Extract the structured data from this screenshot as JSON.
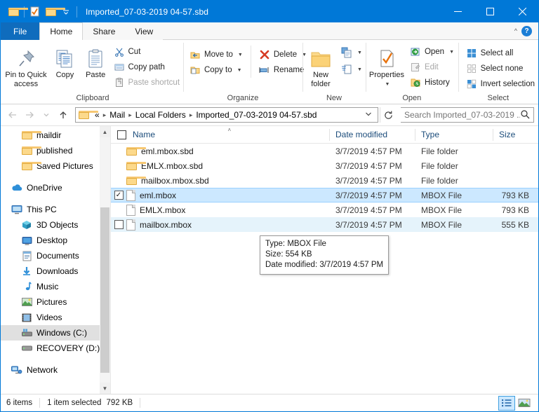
{
  "window": {
    "title": "Imported_07-03-2019 04-57.sbd",
    "accent": "#0078d7",
    "quick_access": [
      "folder-icon",
      "properties-check-icon",
      "folder-icon",
      "chevron-down-icon"
    ],
    "controls": {
      "minimize": "minimize-icon",
      "maximize": "maximize-icon",
      "close": "close-icon"
    }
  },
  "ribbon": {
    "tabs": [
      {
        "label": "File",
        "type": "file"
      },
      {
        "label": "Home",
        "type": "active"
      },
      {
        "label": "Share",
        "type": "inactive"
      },
      {
        "label": "View",
        "type": "inactive"
      }
    ],
    "collapse_icon": "chevron-up-icon",
    "help_label": "?",
    "groups": [
      {
        "name": "Clipboard",
        "big": [
          {
            "label": "Pin to Quick access",
            "icon": "pin-icon"
          },
          {
            "label": "Copy",
            "icon": "copy-icon"
          },
          {
            "label": "Paste",
            "icon": "paste-icon"
          }
        ],
        "small": [
          {
            "label": "Cut",
            "icon": "scissors-icon",
            "disabled": false
          },
          {
            "label": "Copy path",
            "icon": "copy-path-icon",
            "disabled": false
          },
          {
            "label": "Paste shortcut",
            "icon": "paste-shortcut-icon",
            "disabled": true
          }
        ]
      },
      {
        "name": "Organize",
        "small": [
          {
            "label": "Move to",
            "icon": "move-to-icon",
            "dropdown": true
          },
          {
            "label": "Copy to",
            "icon": "copy-to-icon",
            "dropdown": true
          }
        ],
        "small2": [
          {
            "label": "Delete",
            "icon": "delete-x-icon",
            "dropdown": true
          },
          {
            "label": "Rename",
            "icon": "rename-icon",
            "dropdown": false
          }
        ]
      },
      {
        "name": "New",
        "big": [
          {
            "label": "New folder",
            "icon": "new-folder-icon"
          }
        ],
        "small": [
          {
            "label": "",
            "icon": "new-item-icon",
            "dropdown": true
          },
          {
            "label": "",
            "icon": "easy-access-icon",
            "dropdown": true
          }
        ]
      },
      {
        "name": "Open",
        "big": [
          {
            "label": "Properties",
            "icon": "properties-icon",
            "dropdown": true
          }
        ],
        "small": [
          {
            "label": "Open",
            "icon": "open-icon",
            "dropdown": true,
            "disabled": false
          },
          {
            "label": "Edit",
            "icon": "edit-icon",
            "dropdown": false,
            "disabled": true
          },
          {
            "label": "History",
            "icon": "history-icon",
            "dropdown": false,
            "disabled": false
          }
        ]
      },
      {
        "name": "Select",
        "small": [
          {
            "label": "Select all",
            "icon": "select-all-icon"
          },
          {
            "label": "Select none",
            "icon": "select-none-icon"
          },
          {
            "label": "Invert selection",
            "icon": "invert-selection-icon"
          }
        ]
      }
    ]
  },
  "address": {
    "back_icon": "arrow-left-icon",
    "forward_icon": "arrow-right-icon",
    "recent_icon": "chevron-down-icon",
    "up_icon": "arrow-up-icon",
    "folder_icon": "folder-icon",
    "overflow": "«",
    "crumbs": [
      "Mail",
      "Local Folders",
      "Imported_07-03-2019 04-57.sbd"
    ],
    "dropdown_icon": "chevron-down-icon",
    "refresh_icon": "refresh-icon",
    "search_placeholder": "Search Imported_07-03-2019 ...",
    "search_value": "",
    "search_icon": "search-icon"
  },
  "sidebar": {
    "items": [
      {
        "label": "maildir",
        "icon": "folder-icon",
        "indent": 1,
        "selected": false
      },
      {
        "label": "published",
        "icon": "folder-icon",
        "indent": 1,
        "selected": false
      },
      {
        "label": "Saved Pictures",
        "icon": "folder-icon",
        "indent": 1,
        "selected": false
      },
      {
        "label": "",
        "icon": "spacer",
        "indent": 0,
        "selected": false
      },
      {
        "label": "OneDrive",
        "icon": "onedrive-icon",
        "indent": 0,
        "selected": false
      },
      {
        "label": "",
        "icon": "spacer",
        "indent": 0,
        "selected": false
      },
      {
        "label": "This PC",
        "icon": "this-pc-icon",
        "indent": 0,
        "selected": false
      },
      {
        "label": "3D Objects",
        "icon": "3d-objects-icon",
        "indent": 1,
        "selected": false
      },
      {
        "label": "Desktop",
        "icon": "desktop-icon",
        "indent": 1,
        "selected": false
      },
      {
        "label": "Documents",
        "icon": "documents-icon",
        "indent": 1,
        "selected": false
      },
      {
        "label": "Downloads",
        "icon": "downloads-icon",
        "indent": 1,
        "selected": false
      },
      {
        "label": "Music",
        "icon": "music-icon",
        "indent": 1,
        "selected": false
      },
      {
        "label": "Pictures",
        "icon": "pictures-icon",
        "indent": 1,
        "selected": false
      },
      {
        "label": "Videos",
        "icon": "videos-icon",
        "indent": 1,
        "selected": false
      },
      {
        "label": "Windows (C:)",
        "icon": "drive-icon",
        "indent": 1,
        "selected": true
      },
      {
        "label": "RECOVERY (D:)",
        "icon": "drive-icon",
        "indent": 1,
        "selected": false
      },
      {
        "label": "",
        "icon": "spacer",
        "indent": 0,
        "selected": false
      },
      {
        "label": "Network",
        "icon": "network-icon",
        "indent": 0,
        "selected": false
      }
    ],
    "scroll_up_icon": "chevron-up-icon",
    "scroll_down_icon": "chevron-down-icon"
  },
  "filelist": {
    "columns": [
      {
        "label": "Name",
        "sorted": true
      },
      {
        "label": "Date modified",
        "sorted": false
      },
      {
        "label": "Type",
        "sorted": false
      },
      {
        "label": "Size",
        "sorted": false
      }
    ],
    "sort_indicator": "˄",
    "rows": [
      {
        "name": "eml.mbox.sbd",
        "date": "3/7/2019 4:57 PM",
        "type": "File folder",
        "size": "",
        "icon": "folder-icon",
        "checked": false,
        "show_check": false,
        "state": "normal"
      },
      {
        "name": "EMLX.mbox.sbd",
        "date": "3/7/2019 4:57 PM",
        "type": "File folder",
        "size": "",
        "icon": "folder-icon",
        "checked": false,
        "show_check": false,
        "state": "normal"
      },
      {
        "name": "mailbox.mbox.sbd",
        "date": "3/7/2019 4:57 PM",
        "type": "File folder",
        "size": "",
        "icon": "folder-icon",
        "checked": false,
        "show_check": false,
        "state": "normal"
      },
      {
        "name": "eml.mbox",
        "date": "3/7/2019 4:57 PM",
        "type": "MBOX File",
        "size": "793 KB",
        "icon": "file-icon",
        "checked": true,
        "show_check": true,
        "state": "selected"
      },
      {
        "name": "EMLX.mbox",
        "date": "3/7/2019 4:57 PM",
        "type": "MBOX File",
        "size": "793 KB",
        "icon": "file-icon",
        "checked": false,
        "show_check": false,
        "state": "normal"
      },
      {
        "name": "mailbox.mbox",
        "date": "3/7/2019 4:57 PM",
        "type": "MBOX File",
        "size": "555 KB",
        "icon": "file-icon",
        "checked": false,
        "show_check": true,
        "state": "hover"
      }
    ],
    "checkmark": "✓"
  },
  "tooltip": {
    "line1": "Type: MBOX File",
    "line2": "Size: 554 KB",
    "line3": "Date modified: 3/7/2019 4:57 PM"
  },
  "status": {
    "item_count": "6 items",
    "selection": "1 item selected",
    "selection_size": "792 KB",
    "views": [
      {
        "name": "details-view",
        "active": true
      },
      {
        "name": "large-icons-view",
        "active": false
      }
    ]
  }
}
